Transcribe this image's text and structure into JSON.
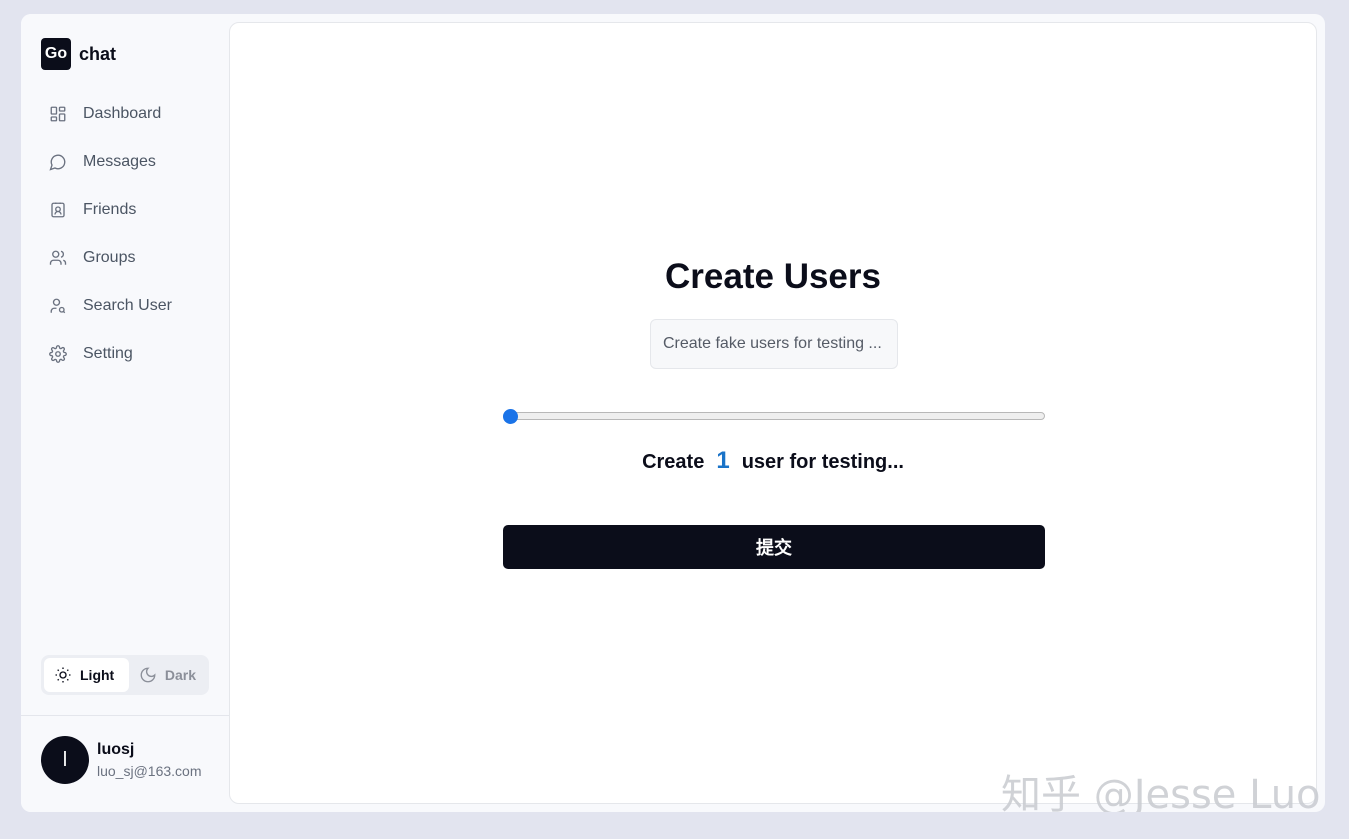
{
  "brand": {
    "mark": "Go",
    "name": "chat"
  },
  "nav": [
    {
      "label": "Dashboard",
      "icon": "dashboard-icon"
    },
    {
      "label": "Messages",
      "icon": "message-icon"
    },
    {
      "label": "Friends",
      "icon": "contact-icon"
    },
    {
      "label": "Groups",
      "icon": "users-icon"
    },
    {
      "label": "Search User",
      "icon": "user-search-icon"
    },
    {
      "label": "Setting",
      "icon": "gear-icon"
    }
  ],
  "theme": {
    "light": "Light",
    "dark": "Dark",
    "selected": "Light"
  },
  "user": {
    "initial": "l",
    "name": "luosj",
    "email": "luo_sj@163.com"
  },
  "main": {
    "title": "Create Users",
    "input_placeholder": "Create fake users for testing ...",
    "slider_value": 1,
    "count_prefix": "Create",
    "count_value": "1",
    "count_suffix": "user for testing...",
    "submit_label": "提交"
  },
  "watermark": "知乎 @Jesse Luo",
  "colors": {
    "accent": "#1a73e8",
    "primary": "#0b0d1a",
    "background": "#e2e4ef"
  }
}
